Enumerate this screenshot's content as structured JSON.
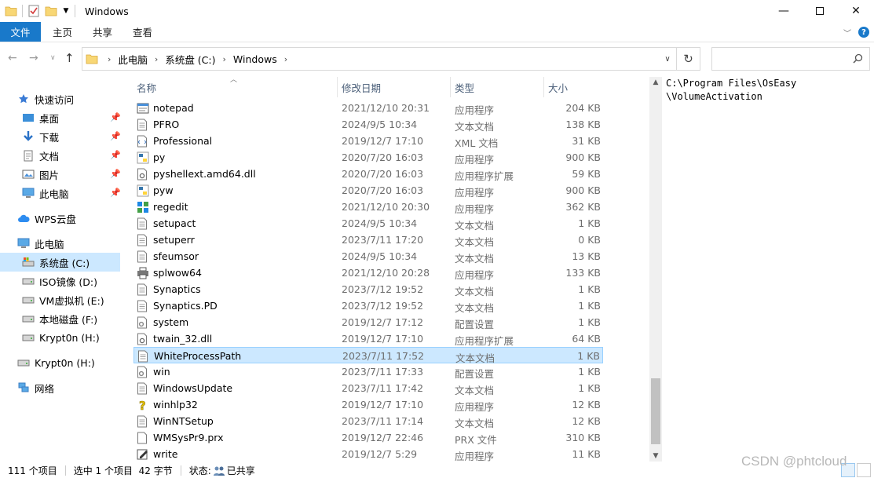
{
  "window": {
    "title": "Windows"
  },
  "ribbon": {
    "tabs": [
      "文件",
      "主页",
      "共享",
      "查看"
    ],
    "help": "?"
  },
  "address": {
    "crumbs": [
      "此电脑",
      "系统盘 (C:)",
      "Windows"
    ],
    "search_placeholder": ""
  },
  "nav": {
    "quick_access": "快速访问",
    "pinned": [
      {
        "label": "桌面",
        "icon": "desktop-icon"
      },
      {
        "label": "下载",
        "icon": "download-icon"
      },
      {
        "label": "文档",
        "icon": "documents-icon"
      },
      {
        "label": "图片",
        "icon": "pictures-icon"
      },
      {
        "label": "此电脑",
        "icon": "computer-icon"
      }
    ],
    "wps": "WPS云盘",
    "this_pc": "此电脑",
    "drives": [
      {
        "label": "系统盘 (C:)",
        "selected": true
      },
      {
        "label": "ISO镜像 (D:)"
      },
      {
        "label": "VM虚拟机 (E:)"
      },
      {
        "label": "本地磁盘 (F:)"
      },
      {
        "label": "Krypt0n (H:)"
      }
    ],
    "krypton": "Krypt0n (H:)",
    "network": "网络"
  },
  "columns": {
    "name": "名称",
    "date": "修改日期",
    "type": "类型",
    "size": "大小"
  },
  "files": [
    {
      "name": "notepad",
      "date": "2021/12/10 20:31",
      "type": "应用程序",
      "size": "204 KB",
      "icon": "notepad-app-icon"
    },
    {
      "name": "PFRO",
      "date": "2024/9/5 10:34",
      "type": "文本文档",
      "size": "138 KB",
      "icon": "text-file-icon"
    },
    {
      "name": "Professional",
      "date": "2019/12/7 17:10",
      "type": "XML 文档",
      "size": "31 KB",
      "icon": "xml-file-icon"
    },
    {
      "name": "py",
      "date": "2020/7/20 16:03",
      "type": "应用程序",
      "size": "900 KB",
      "icon": "python-icon"
    },
    {
      "name": "pyshellext.amd64.dll",
      "date": "2020/7/20 16:03",
      "type": "应用程序扩展",
      "size": "59 KB",
      "icon": "dll-file-icon"
    },
    {
      "name": "pyw",
      "date": "2020/7/20 16:03",
      "type": "应用程序",
      "size": "900 KB",
      "icon": "python-icon"
    },
    {
      "name": "regedit",
      "date": "2021/12/10 20:30",
      "type": "应用程序",
      "size": "362 KB",
      "icon": "regedit-icon"
    },
    {
      "name": "setupact",
      "date": "2024/9/5 10:34",
      "type": "文本文档",
      "size": "1 KB",
      "icon": "text-file-icon"
    },
    {
      "name": "setuperr",
      "date": "2023/7/11 17:20",
      "type": "文本文档",
      "size": "0 KB",
      "icon": "text-file-icon"
    },
    {
      "name": "sfeumsor",
      "date": "2024/9/5 10:34",
      "type": "文本文档",
      "size": "13 KB",
      "icon": "text-file-icon"
    },
    {
      "name": "splwow64",
      "date": "2021/12/10 20:28",
      "type": "应用程序",
      "size": "133 KB",
      "icon": "printer-icon"
    },
    {
      "name": "Synaptics",
      "date": "2023/7/12 19:52",
      "type": "文本文档",
      "size": "1 KB",
      "icon": "text-file-icon"
    },
    {
      "name": "Synaptics.PD",
      "date": "2023/7/12 19:52",
      "type": "文本文档",
      "size": "1 KB",
      "icon": "text-file-icon"
    },
    {
      "name": "system",
      "date": "2019/12/7 17:12",
      "type": "配置设置",
      "size": "1 KB",
      "icon": "config-file-icon"
    },
    {
      "name": "twain_32.dll",
      "date": "2019/12/7 17:10",
      "type": "应用程序扩展",
      "size": "64 KB",
      "icon": "dll-file-icon"
    },
    {
      "name": "WhiteProcessPath",
      "date": "2023/7/11 17:52",
      "type": "文本文档",
      "size": "1 KB",
      "icon": "text-file-icon",
      "selected": true
    },
    {
      "name": "win",
      "date": "2023/7/11 17:33",
      "type": "配置设置",
      "size": "1 KB",
      "icon": "config-file-icon"
    },
    {
      "name": "WindowsUpdate",
      "date": "2023/7/11 17:42",
      "type": "文本文档",
      "size": "1 KB",
      "icon": "text-file-icon"
    },
    {
      "name": "winhlp32",
      "date": "2019/12/7 17:10",
      "type": "应用程序",
      "size": "12 KB",
      "icon": "help-app-icon"
    },
    {
      "name": "WinNTSetup",
      "date": "2023/7/11 17:14",
      "type": "文本文档",
      "size": "12 KB",
      "icon": "text-file-icon"
    },
    {
      "name": "WMSysPr9.prx",
      "date": "2019/12/7 22:46",
      "type": "PRX 文件",
      "size": "310 KB",
      "icon": "blank-file-icon"
    },
    {
      "name": "write",
      "date": "2019/12/7 5:29",
      "type": "应用程序",
      "size": "11 KB",
      "icon": "write-app-icon"
    }
  ],
  "preview": {
    "lines": [
      "C:\\Program Files\\OsEasy",
      "\\VolumeActivation"
    ]
  },
  "status": {
    "count": "111 个项目",
    "selected": "选中 1 个项目  42 字节",
    "state_label": "状态:",
    "state_value": "已共享"
  },
  "watermark": "CSDN @phtcloud",
  "colors": {
    "accent": "#1979ca",
    "selection": "#cce8ff",
    "selection_border": "#99d1ff",
    "header_text": "#4c607a"
  }
}
